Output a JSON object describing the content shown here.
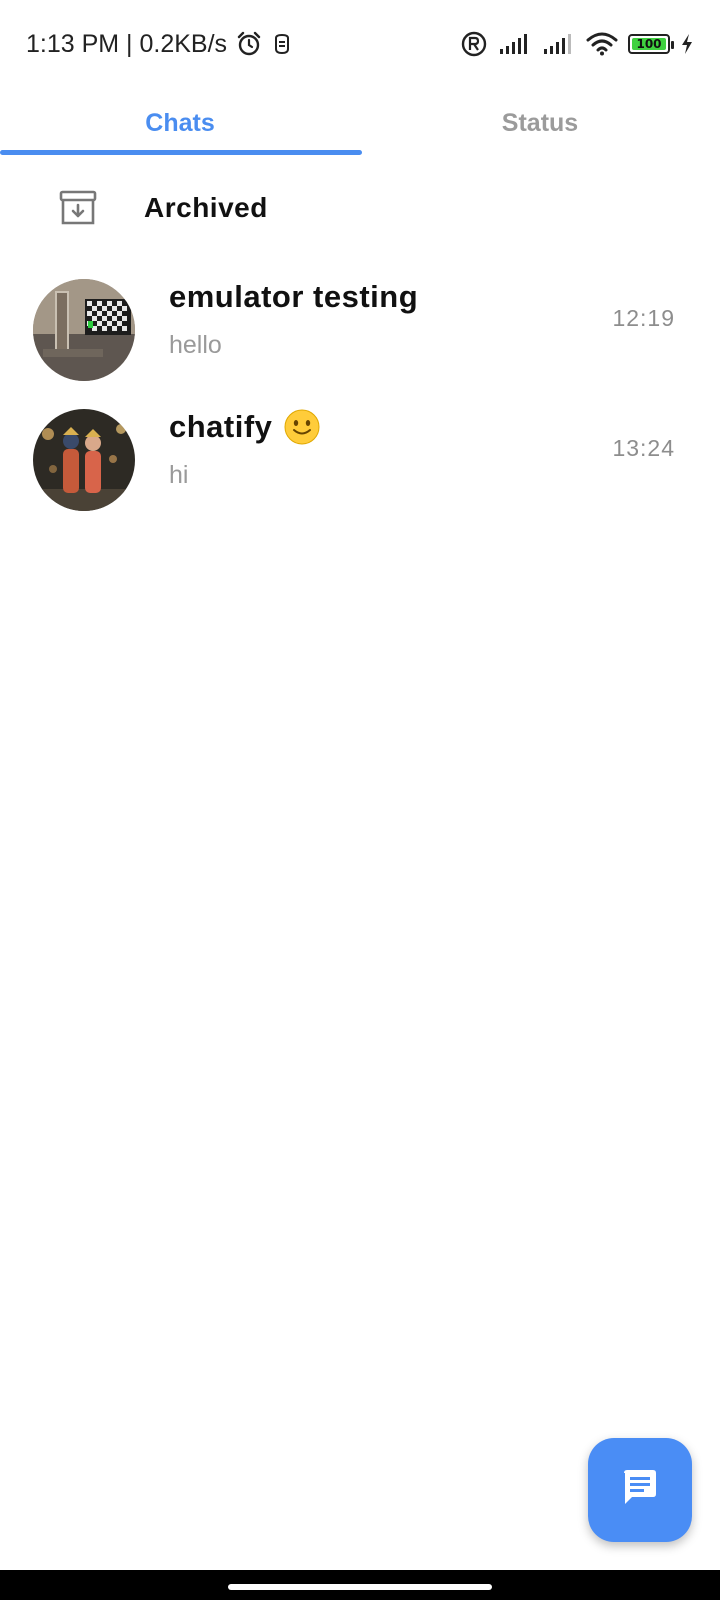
{
  "status_bar": {
    "time_speed": "1:13 PM | 0.2KB/s",
    "battery_level": "100",
    "icons": [
      "alarm-icon",
      "notification-icon",
      "registered-icon",
      "signal-icon",
      "signal-icon",
      "wifi-icon",
      "battery-icon",
      "charging-icon"
    ]
  },
  "tabs": [
    {
      "label": "Chats",
      "active": true
    },
    {
      "label": "Status",
      "active": false
    }
  ],
  "archived": {
    "label": "Archived",
    "icon": "archive-icon"
  },
  "chats": [
    {
      "name": "emulator testing",
      "message": "hello",
      "time": "12:19"
    },
    {
      "name": "chatify",
      "message": "hi",
      "time": "13:24",
      "emoji": "slightly-smiling-face"
    }
  ],
  "fab": {
    "icon": "new-chat-icon"
  },
  "colors": {
    "accent": "#4a8df0",
    "fab": "#4a8df5",
    "muted_text": "#9a9a9a",
    "battery_fill": "#3fd13f"
  }
}
